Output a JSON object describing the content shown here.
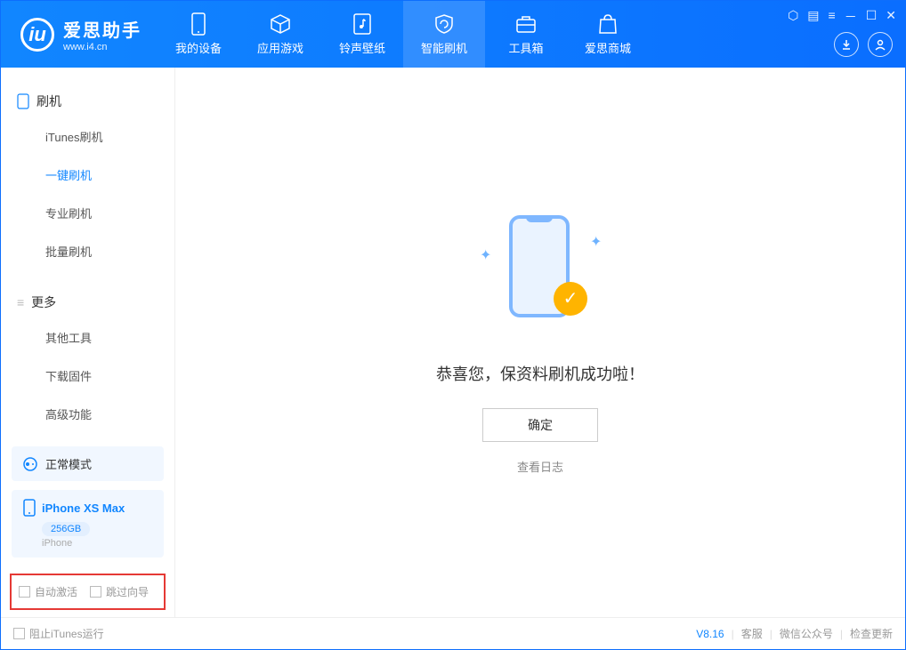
{
  "brand": {
    "name": "爱思助手",
    "url": "www.i4.cn"
  },
  "nav": {
    "tabs": [
      {
        "label": "我的设备"
      },
      {
        "label": "应用游戏"
      },
      {
        "label": "铃声壁纸"
      },
      {
        "label": "智能刷机"
      },
      {
        "label": "工具箱"
      },
      {
        "label": "爱思商城"
      }
    ]
  },
  "sidebar": {
    "group1_title": "刷机",
    "group1_items": [
      {
        "label": "iTunes刷机"
      },
      {
        "label": "一键刷机"
      },
      {
        "label": "专业刷机"
      },
      {
        "label": "批量刷机"
      }
    ],
    "group2_title": "更多",
    "group2_items": [
      {
        "label": "其他工具"
      },
      {
        "label": "下载固件"
      },
      {
        "label": "高级功能"
      }
    ]
  },
  "mode": {
    "label": "正常模式"
  },
  "device": {
    "name": "iPhone XS Max",
    "storage": "256GB",
    "type": "iPhone"
  },
  "bottom_options": {
    "auto_activate": "自动激活",
    "skip_guide": "跳过向导"
  },
  "main": {
    "success_msg": "恭喜您，保资料刷机成功啦！",
    "ok_btn": "确定",
    "view_log": "查看日志"
  },
  "statusbar": {
    "block_itunes": "阻止iTunes运行",
    "version": "V8.16",
    "links": {
      "cs": "客服",
      "wechat": "微信公众号",
      "update": "检查更新"
    }
  }
}
